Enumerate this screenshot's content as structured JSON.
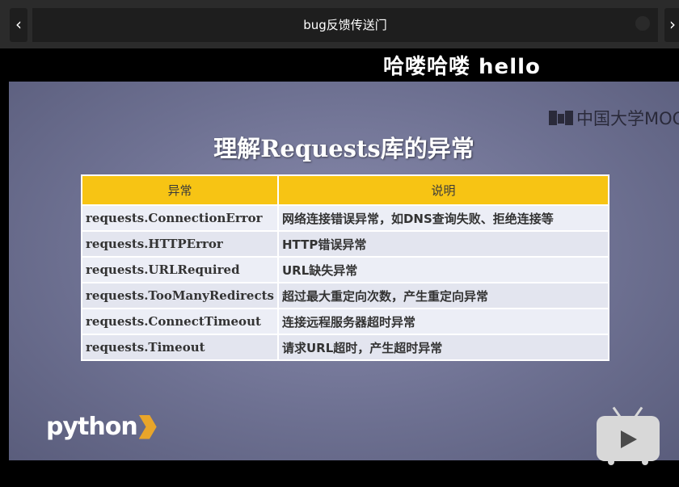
{
  "header": {
    "title": "bug反馈传送门",
    "back_icon": "‹",
    "forward_icon": "›"
  },
  "danmaku": "哈喽哈喽  hello",
  "slide": {
    "brand": "中国大学MOOC",
    "title": "理解Requests库的异常",
    "table": {
      "headers": [
        "异常",
        "说明"
      ],
      "rows": [
        {
          "name": "requests.ConnectionError",
          "desc": "网络连接错误异常，如DNS查询失败、拒绝连接等"
        },
        {
          "name": "requests.HTTPError",
          "desc": "HTTP错误异常"
        },
        {
          "name": "requests.URLRequired",
          "desc": "URL缺失异常"
        },
        {
          "name": "requests.TooManyRedirects",
          "desc": "超过最大重定向次数，产生重定向异常"
        },
        {
          "name": "requests.ConnectTimeout",
          "desc": "连接远程服务器超时异常"
        },
        {
          "name": "requests.Timeout",
          "desc": "请求URL超时，产生超时异常"
        }
      ]
    },
    "python_logo": "python"
  },
  "colors": {
    "header_bg": "#f7c414",
    "slide_bg": "#6e7192"
  }
}
